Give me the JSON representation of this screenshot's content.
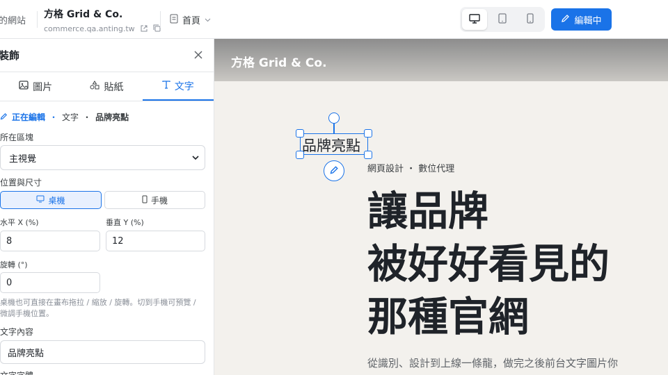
{
  "topbar": {
    "site_crumb": "的網站",
    "brand_name": "方格 Grid & Co.",
    "brand_domain": "commerce.qa.anting.tw",
    "page_select": "首頁",
    "edit_button": "編輯中",
    "devices": [
      "desktop-icon",
      "tablet-icon",
      "mobile-icon"
    ],
    "accent": "#1a73e8"
  },
  "panel": {
    "title": "裝飾",
    "tabs": [
      {
        "label": "圖片",
        "icon": "image-icon"
      },
      {
        "label": "貼紙",
        "icon": "shapes-icon"
      },
      {
        "label": "文字",
        "icon": "text-icon"
      }
    ],
    "breadcrumb": {
      "editing": "正在編輯",
      "type": "文字",
      "name": "品牌亮點"
    },
    "section_label": "所在區塊",
    "section_value": "主視覺",
    "position_label": "位置與尺寸",
    "seg_desktop": "桌機",
    "seg_mobile": "手機",
    "x_label": "水平 X (%)",
    "x_value": "8",
    "y_label": "垂直 Y (%)",
    "y_value": "12",
    "rotation_label": "旋轉 (°)",
    "rotation_value": "0",
    "hint": "桌機也可直接在畫布拖拉 / 縮放 / 旋轉。切到手機可預覽 / 微調手機位置。",
    "content_label": "文字內容",
    "content_value": "品牌亮點",
    "next_label": "文字字體"
  },
  "canvas": {
    "hero_brand": "方格 Grid & Co.",
    "selected_text": "品牌亮點",
    "eyebrow": "網頁設計 ・ 數位代理",
    "headline_1": "讓品牌",
    "headline_2": "被好好看見的",
    "headline_3": "那種官網",
    "subline": "從識別、設計到上線一條龍，做完之後前台文字圖片你"
  }
}
